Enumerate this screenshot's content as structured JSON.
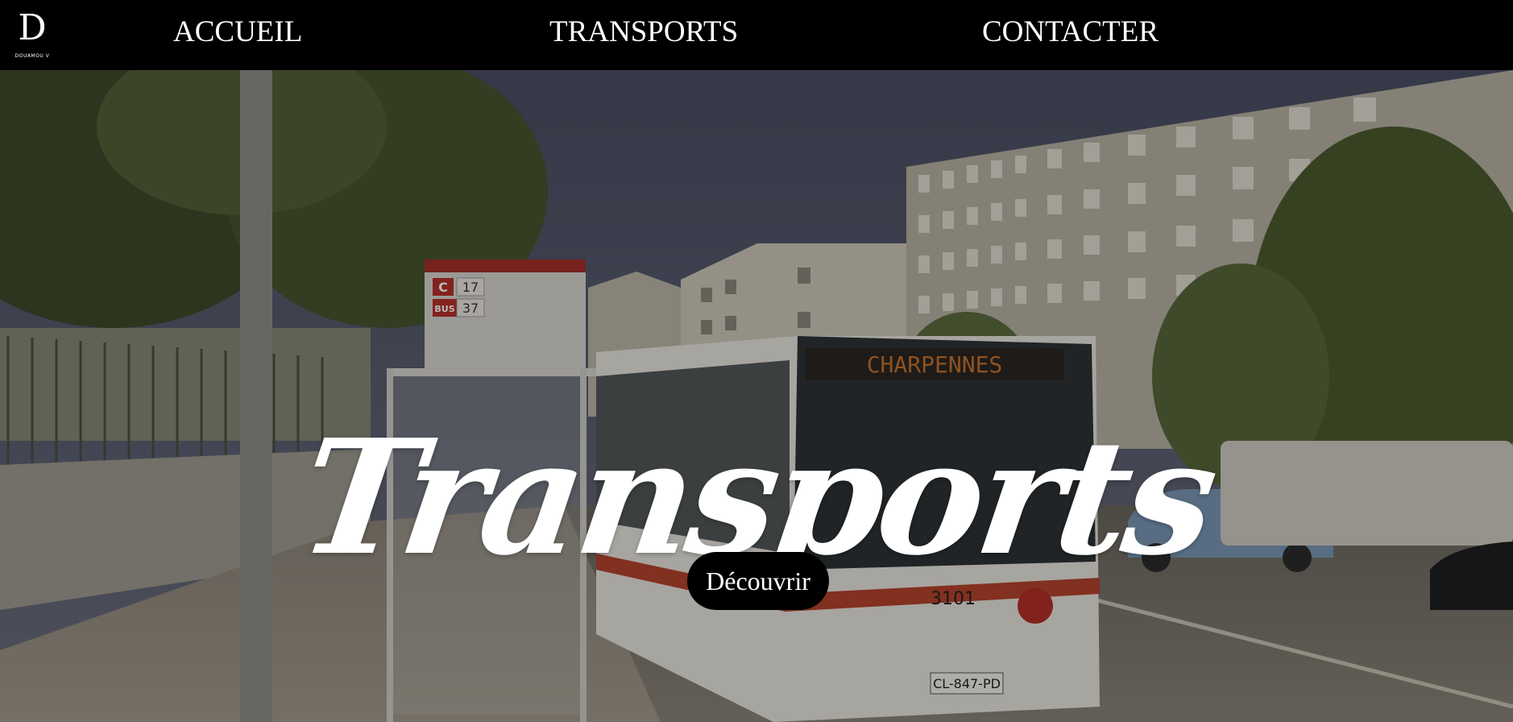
{
  "header": {
    "logo": {
      "letter": "D",
      "subtext": "DOUAMOU V"
    },
    "nav": [
      {
        "label": "ACCUEIL"
      },
      {
        "label": "TRANSPORTS"
      },
      {
        "label": "CONTACTER"
      }
    ]
  },
  "hero": {
    "title": "Transports",
    "cta_label": "Découvrir",
    "image_icon": "bus-street-photo",
    "scene_text": {
      "stop_line_c": "C",
      "stop_num_17": "17",
      "stop_line_bus": "BUS",
      "stop_num_37": "37",
      "bus_destination": "CHARPENNES",
      "bus_number": "3101",
      "plate": "CL-847-PD"
    }
  },
  "colors": {
    "nav_bg": "#000000",
    "text": "#ffffff",
    "button_bg": "#000000"
  }
}
